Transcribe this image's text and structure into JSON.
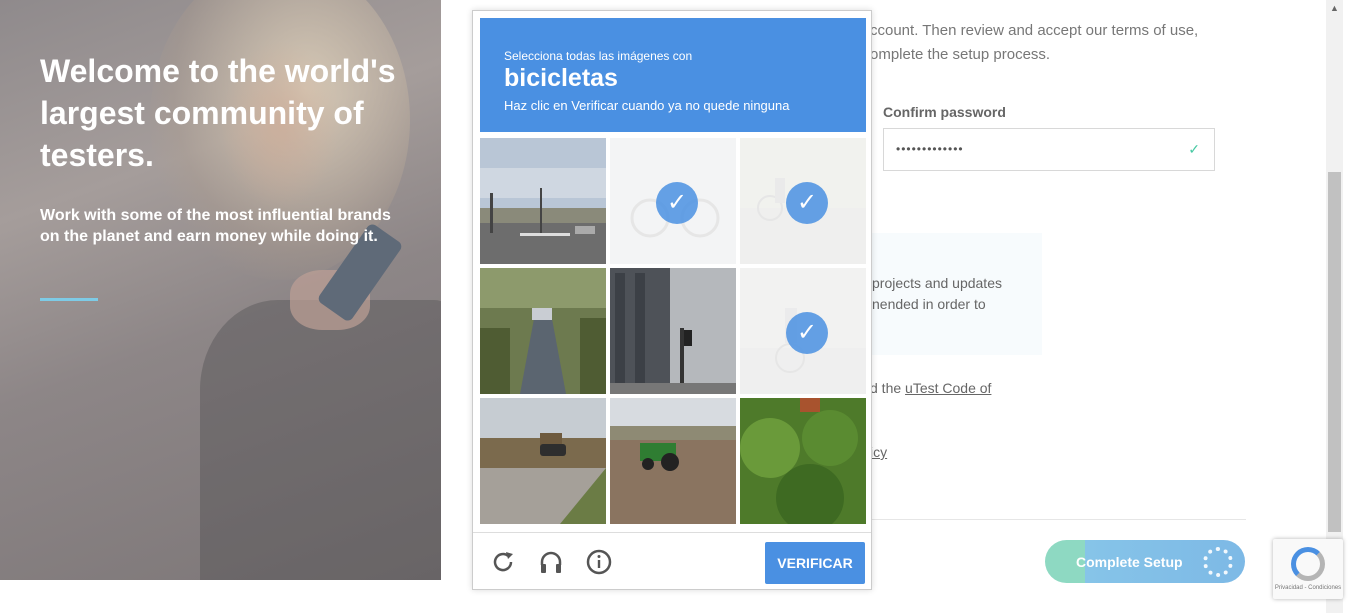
{
  "hero": {
    "title": "Welcome to the world's largest community of testers.",
    "subtitle": "Work with some of the most influential brands on the planet and earn money while doing it."
  },
  "form": {
    "intro_line1": "ccount. Then review and accept our terms of use,",
    "intro_line2": "omplete the setup process.",
    "confirm_password_label": "Confirm password",
    "confirm_password_value": "•••••••••••••",
    "info_line1": "projects and updates",
    "info_line2": "nended in order to",
    "code_prefix": "d the ",
    "code_link": "uTest Code of",
    "privacy_link": "icy",
    "complete_button": "Complete Setup"
  },
  "captcha": {
    "instruction_small": "Selecciona todas las imágenes con",
    "keyword": "bicicletas",
    "hint": "Haz clic en Verificar cuando ya no quede ninguna",
    "verify_button": "VERIFICAR",
    "tiles": [
      {
        "scene": "street-intersection-sky",
        "selected": false
      },
      {
        "scene": "faded-bicycle",
        "selected": true
      },
      {
        "scene": "bicycle-rider",
        "selected": true
      },
      {
        "scene": "tree-lined-road-car",
        "selected": false
      },
      {
        "scene": "city-buildings-traffic-light",
        "selected": false
      },
      {
        "scene": "cyclist-street",
        "selected": true
      },
      {
        "scene": "residential-street-car",
        "selected": false
      },
      {
        "scene": "tractor-field",
        "selected": false
      },
      {
        "scene": "green-shrubs",
        "selected": false
      }
    ],
    "icons": [
      "reload-icon",
      "headphones-icon",
      "info-icon"
    ]
  },
  "recaptcha_badge": {
    "terms": "Privacidad - Condiciones"
  },
  "colors": {
    "captcha_blue": "#4a90e2",
    "accent_teal": "#8ed9c2",
    "hero_rule": "#7ecbe6"
  }
}
